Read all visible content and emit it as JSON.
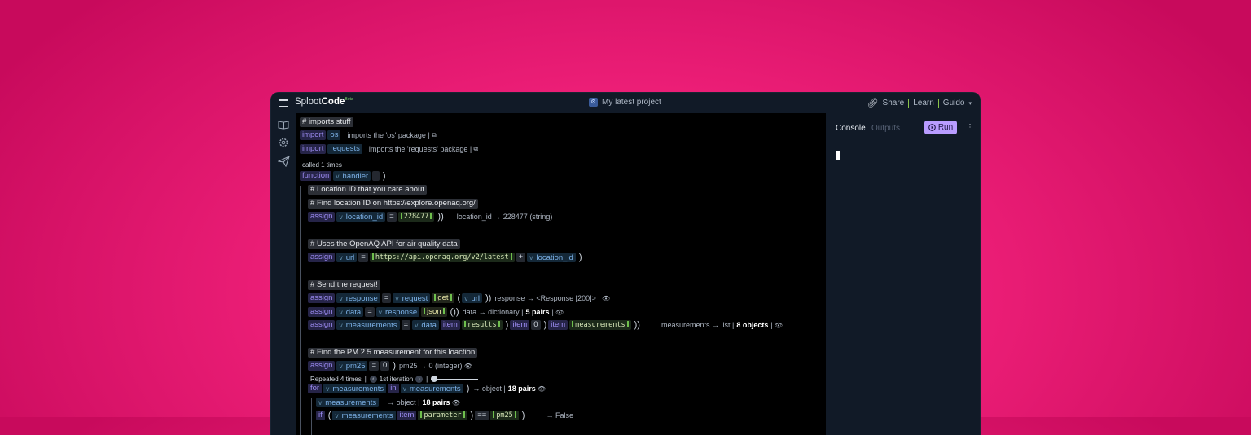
{
  "header": {
    "logo_main": "Sploot",
    "logo_bold": "Code",
    "logo_badge": "Beta",
    "project_name": "My latest project",
    "share": "Share",
    "learn": "Learn",
    "user": "Guido"
  },
  "console": {
    "tab_console": "Console",
    "tab_outputs": "Outputs",
    "run_label": "Run"
  },
  "code": {
    "c_imports": "imports stuff",
    "kw_import": "import",
    "mod_os": "os",
    "ann_os": "imports the 'os' package |",
    "mod_requests": "requests",
    "ann_requests": "imports the 'requests' package |",
    "called": "called 1 times",
    "kw_function": "function",
    "fn_handler": "handler",
    "c_location": "Location ID that you care about",
    "c_find": "Find location ID on https://explore.openaq.org/",
    "kw_assign": "assign",
    "var_location_id": "location_id",
    "str_228477": "228477",
    "ann_location": "location_id → 228477 (string)",
    "c_openaq": "Uses the OpenAQ API for air quality data",
    "var_url": "url",
    "str_url": "https://api.openaq.org/v2/latest",
    "c_send": "Send the request!",
    "var_response": "response",
    "var_request": "request",
    "attr_get": "get",
    "ann_response": "response → <Response [200]> |",
    "var_data": "data",
    "attr_json": "json",
    "ann_data": "data → dictionary |",
    "ann_data_bold": "5 pairs",
    "var_measurements": "measurements",
    "kw_item": "item",
    "str_results": "results",
    "num_0": "0",
    "str_measurements": "measurements",
    "ann_meas": "measurements → list |",
    "ann_meas_bold": "8 objects",
    "c_pm": "Find the PM 2.5 measurement for this loaction",
    "var_pm25": "pm25",
    "ann_pm25": "pm25 → 0 (integer)",
    "repeat": "Repeated 4 times",
    "iteration": "1st iteration",
    "kw_for": "for",
    "kw_in": "in",
    "ann_for": "→ object |",
    "ann_for_bold": "18 pairs",
    "ann_obj": "→ object |",
    "ann_obj_bold": "18 pairs",
    "kw_if": "if",
    "str_parameter": "parameter",
    "op_eq": "==",
    "str_pm25": "pm25",
    "ann_false": "→ False",
    "op_assign": "=",
    "op_plus": "+",
    "hash": "#",
    "v": "v"
  }
}
